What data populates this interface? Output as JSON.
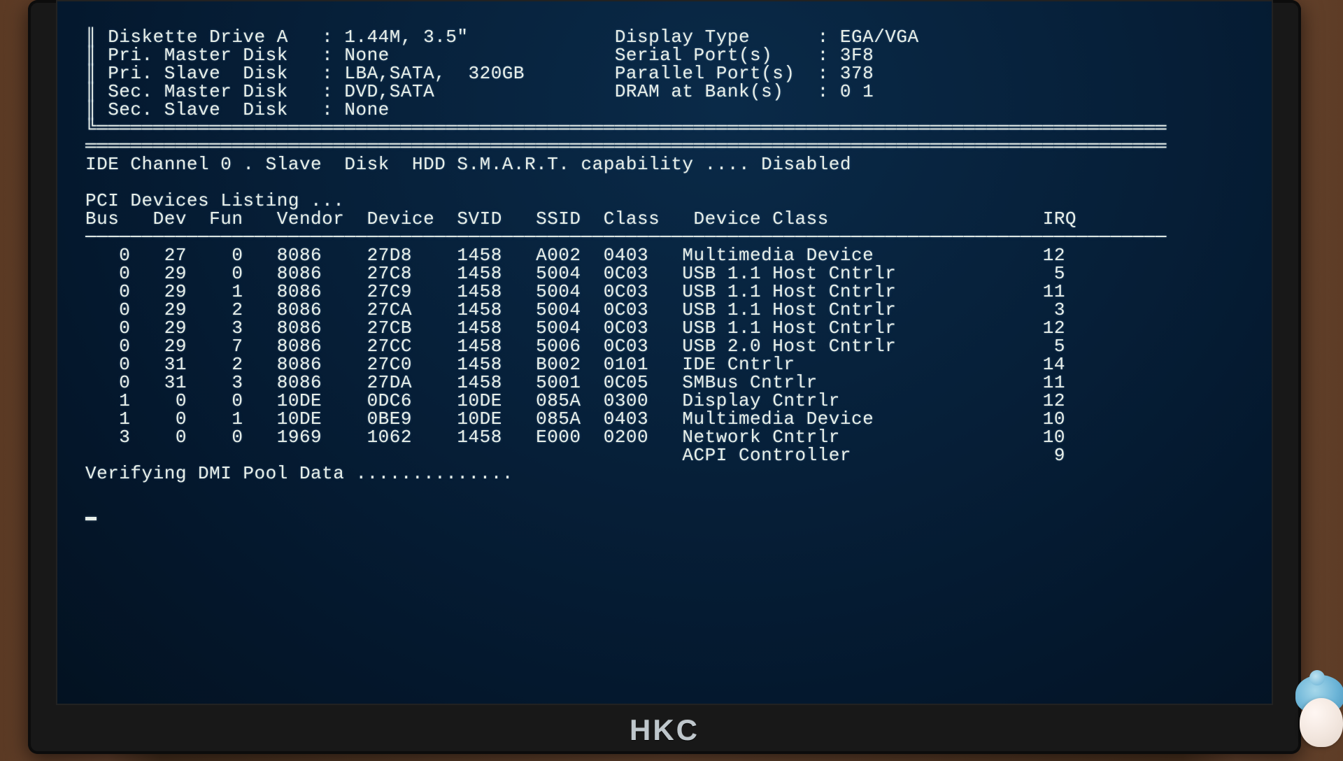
{
  "monitor_brand": "HKC",
  "hw_left": [
    {
      "label": "Diskette Drive A",
      "value": "1.44M, 3.5\""
    },
    {
      "label": "Pri. Master Disk",
      "value": "None"
    },
    {
      "label": "Pri. Slave  Disk",
      "value": "LBA,SATA,  320GB"
    },
    {
      "label": "Sec. Master Disk",
      "value": "DVD,SATA"
    },
    {
      "label": "Sec. Slave  Disk",
      "value": "None"
    }
  ],
  "hw_right": [
    {
      "label": "Display Type",
      "value": "EGA/VGA"
    },
    {
      "label": "Serial Port(s)",
      "value": "3F8"
    },
    {
      "label": "Parallel Port(s)",
      "value": "378"
    },
    {
      "label": "DRAM at Bank(s)",
      "value": "0 1"
    }
  ],
  "smart_line": "IDE Channel 0 . Slave  Disk  HDD S.M.A.R.T. capability .... Disabled",
  "pci_title": "PCI Devices Listing ...",
  "pci_headers": [
    "Bus",
    "Dev",
    "Fun",
    "Vendor",
    "Device",
    "SVID",
    "SSID",
    "Class",
    "Device Class",
    "IRQ"
  ],
  "pci_devices": [
    {
      "bus": "0",
      "dev": "27",
      "fun": "0",
      "vendor": "8086",
      "device": "27D8",
      "svid": "1458",
      "ssid": "A002",
      "class": "0403",
      "device_class": "Multimedia Device",
      "irq": "12"
    },
    {
      "bus": "0",
      "dev": "29",
      "fun": "0",
      "vendor": "8086",
      "device": "27C8",
      "svid": "1458",
      "ssid": "5004",
      "class": "0C03",
      "device_class": "USB 1.1 Host Cntrlr",
      "irq": "5"
    },
    {
      "bus": "0",
      "dev": "29",
      "fun": "1",
      "vendor": "8086",
      "device": "27C9",
      "svid": "1458",
      "ssid": "5004",
      "class": "0C03",
      "device_class": "USB 1.1 Host Cntrlr",
      "irq": "11"
    },
    {
      "bus": "0",
      "dev": "29",
      "fun": "2",
      "vendor": "8086",
      "device": "27CA",
      "svid": "1458",
      "ssid": "5004",
      "class": "0C03",
      "device_class": "USB 1.1 Host Cntrlr",
      "irq": "3"
    },
    {
      "bus": "0",
      "dev": "29",
      "fun": "3",
      "vendor": "8086",
      "device": "27CB",
      "svid": "1458",
      "ssid": "5004",
      "class": "0C03",
      "device_class": "USB 1.1 Host Cntrlr",
      "irq": "12"
    },
    {
      "bus": "0",
      "dev": "29",
      "fun": "7",
      "vendor": "8086",
      "device": "27CC",
      "svid": "1458",
      "ssid": "5006",
      "class": "0C03",
      "device_class": "USB 2.0 Host Cntrlr",
      "irq": "5"
    },
    {
      "bus": "0",
      "dev": "31",
      "fun": "2",
      "vendor": "8086",
      "device": "27C0",
      "svid": "1458",
      "ssid": "B002",
      "class": "0101",
      "device_class": "IDE Cntrlr",
      "irq": "14"
    },
    {
      "bus": "0",
      "dev": "31",
      "fun": "3",
      "vendor": "8086",
      "device": "27DA",
      "svid": "1458",
      "ssid": "5001",
      "class": "0C05",
      "device_class": "SMBus Cntrlr",
      "irq": "11"
    },
    {
      "bus": "1",
      "dev": "0",
      "fun": "0",
      "vendor": "10DE",
      "device": "0DC6",
      "svid": "10DE",
      "ssid": "085A",
      "class": "0300",
      "device_class": "Display Cntrlr",
      "irq": "12"
    },
    {
      "bus": "1",
      "dev": "0",
      "fun": "1",
      "vendor": "10DE",
      "device": "0BE9",
      "svid": "10DE",
      "ssid": "085A",
      "class": "0403",
      "device_class": "Multimedia Device",
      "irq": "10"
    },
    {
      "bus": "3",
      "dev": "0",
      "fun": "0",
      "vendor": "1969",
      "device": "1062",
      "svid": "1458",
      "ssid": "E000",
      "class": "0200",
      "device_class": "Network Cntrlr",
      "irq": "10"
    },
    {
      "bus": "",
      "dev": "",
      "fun": "",
      "vendor": "",
      "device": "",
      "svid": "",
      "ssid": "",
      "class": "",
      "device_class": "ACPI Controller",
      "irq": "9"
    }
  ],
  "dmi_line": "Verifying DMI Pool Data .............."
}
